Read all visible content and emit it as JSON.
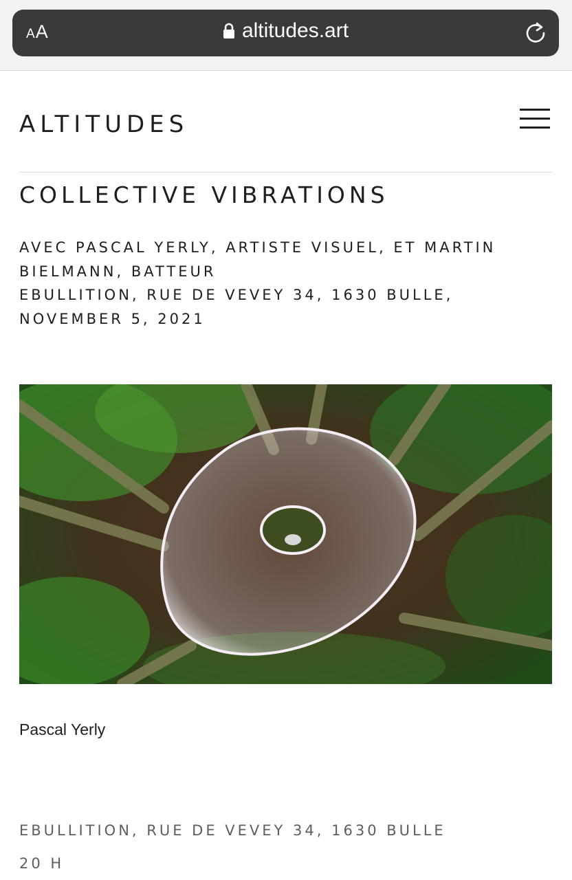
{
  "browser": {
    "text_size_label_small": "A",
    "text_size_label_large": "A",
    "url": "altitudes.art",
    "icons": [
      "lock-icon",
      "reload-icon"
    ]
  },
  "header": {
    "logo": "ALTITUDES",
    "menu_icon": "hamburger-menu-icon"
  },
  "event": {
    "title": "COLLECTIVE VIBRATIONS",
    "subtitle_line1": "AVEC PASCAL YERLY, ARTISTE VISUEL, ET MARTIN BIELMANN, BATTEUR",
    "location_date": "EBULLITION, RUE DE VEVEY 34, 1630 BULLE, NOVEMBER 5, 2021",
    "image_caption": "Pascal Yerly",
    "venue": "EBULLITION, RUE DE VEVEY 34, 1630 BULLE",
    "time": "20 H"
  },
  "colors": {
    "chrome_bg": "#f2f2f2",
    "url_bar": "#3a3a3a",
    "text_primary": "#1e1e1e",
    "text_secondary": "#5e5e5e",
    "divider": "#dcdcdc"
  }
}
